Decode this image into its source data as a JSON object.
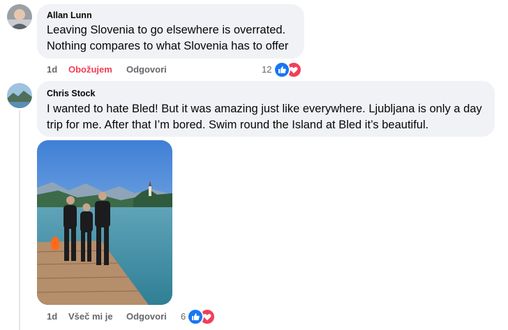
{
  "comments": [
    {
      "author": "Allan Lunn",
      "lines": [
        "Leaving Slovenia to go elsewhere is overrated.",
        "Nothing compares to what Slovenia has to offer"
      ],
      "time": "1d",
      "reaction_label": "Obožujem",
      "reaction_color": "#f33e58",
      "reply_label": "Odgovori",
      "reaction_count": "12",
      "reaction_icons": [
        "like-icon",
        "love-icon"
      ]
    },
    {
      "author": "Chris Stock",
      "lines": [
        "I wanted to hate Bled! But it was amazing just like everywhere. Ljubljana is only a day",
        "trip for me. After that I’m bored. Swim round the Island at Bled it’s beautiful."
      ],
      "time": "1d",
      "reaction_label": "Všeč mi je",
      "reply_label": "Odgovori",
      "reaction_count": "6",
      "reaction_icons": [
        "like-icon",
        "love-icon"
      ],
      "photo_icon": "lake-bled-swimmers-photo"
    }
  ],
  "colors": {
    "like": "#1877f2",
    "love": "#f33e58",
    "bubble": "#f0f2f5",
    "meta": "#65676b"
  }
}
